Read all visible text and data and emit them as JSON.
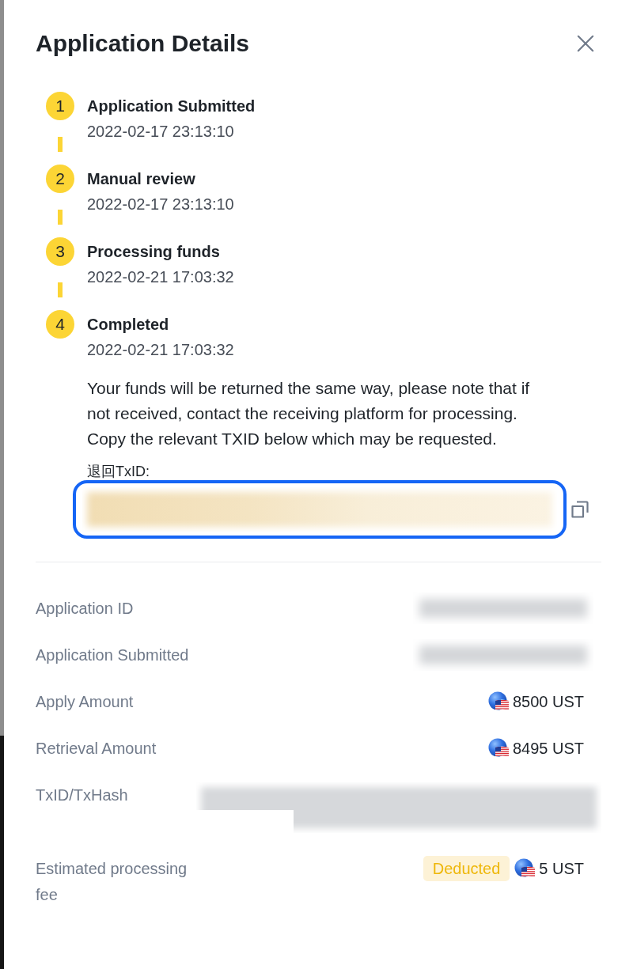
{
  "dialog": {
    "title": "Application Details"
  },
  "steps": [
    {
      "number": "1",
      "title": "Application Submitted",
      "time": "2022-02-17 23:13:10",
      "done": true
    },
    {
      "number": "2",
      "title": "Manual review",
      "time": "2022-02-17 23:13:10",
      "done": true
    },
    {
      "number": "3",
      "title": "Processing funds",
      "time": "2022-02-21 17:03:32",
      "done": true
    },
    {
      "number": "4",
      "title": "Completed",
      "time": "2022-02-21 17:03:32",
      "done": true,
      "note": "Your funds will be returned the same way, please note that if not received, contact the receiving platform for processing. Copy the relevant TXID below which may be requested.",
      "txid_label": "退回TxID:"
    }
  ],
  "details": [
    {
      "label": "Application ID",
      "kind": "redacted"
    },
    {
      "label": "Application Submitted",
      "kind": "redacted"
    },
    {
      "label": "Apply Amount",
      "kind": "amount",
      "value": "8500 UST"
    },
    {
      "label": "Retrieval Amount",
      "kind": "amount",
      "value": "8495 UST"
    },
    {
      "label": "TxID/TxHash",
      "kind": "redacted_long"
    },
    {
      "label": "Estimated processing fee",
      "kind": "amount",
      "badge": "Deducted",
      "value": "5 UST"
    }
  ]
}
